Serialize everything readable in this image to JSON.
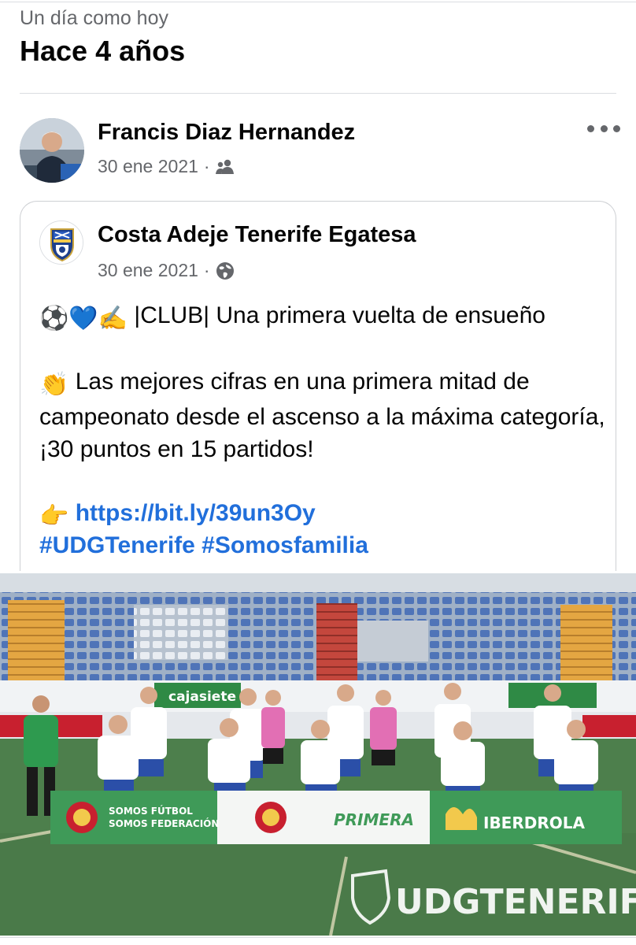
{
  "memory": {
    "kicker": "Un día como hoy",
    "title": "Hace 4 años"
  },
  "post": {
    "author": "Francis Diaz Hernandez",
    "date": "30 ene 2021",
    "separator": "·",
    "audience_icon": "friends-icon",
    "more_icon": "more-options-icon"
  },
  "shared": {
    "page_name": "Costa Adeje Tenerife Egatesa",
    "date": "30 ene 2021",
    "separator": "·",
    "audience_icon": "globe-icon",
    "line1_emojis": "⚽💙✍️",
    "line1_text": "|CLUB| Una primera vuelta de ensueño",
    "body_emoji": "👏",
    "body_text": "Las mejores cifras en una primera mitad de campeonato desde el ascenso a la máxima categoría, ¡30 puntos en 15 partidos!",
    "link_emoji": "👉",
    "link_text": "https://bit.ly/39un3Oy",
    "hashtags": "#UDGTenerife #Somosfamilia"
  },
  "photo": {
    "board_left_line1": "SOMOS FÚTBOL",
    "board_left_line2": "SOMOS FEDERACIÓN",
    "board_primera": "PRIMERA",
    "board_iberdrola": "IBERDROLA",
    "banner_cajasiete": "cajasiete",
    "watermark": "UDGTENERIFE",
    "colors": {
      "grass": "#4d7f4c",
      "seats_blue": "#4f74b8",
      "seats_white": "#e9edf2",
      "stairs_orange": "#e4a642",
      "stairs_red": "#c4473d",
      "kit_blue": "#2b4fa8",
      "keeper_green": "#2e9a4f",
      "referee_pink": "#e26fb4",
      "board_green": "#3f9a58"
    }
  },
  "colors": {
    "text_primary": "#050505",
    "text_secondary": "#65676b",
    "link": "#216fdb",
    "divider": "#dadde1"
  }
}
